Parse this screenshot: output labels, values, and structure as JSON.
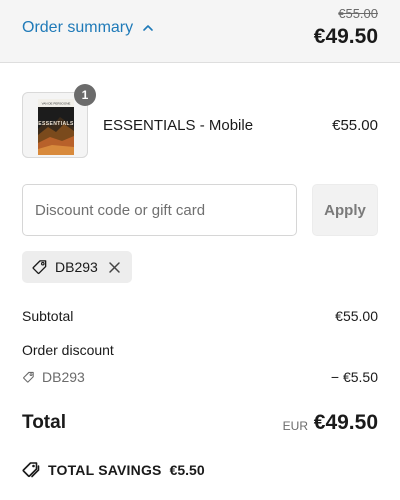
{
  "header": {
    "toggle_label": "Order summary",
    "compare_price": "€55.00",
    "total": "€49.50"
  },
  "line_item": {
    "quantity": "1",
    "name": "ESSENTIALS - Mobile",
    "price": "€55.00",
    "thumbnail": {
      "top_text": "VAN DE PERSOONE",
      "title": "ESSENTIALS"
    }
  },
  "discount_form": {
    "placeholder": "Discount code or gift card",
    "value": "",
    "apply_label": "Apply"
  },
  "applied_code": {
    "code": "DB293",
    "tag_icon": "tag-icon",
    "remove_icon": "close-icon"
  },
  "summary": {
    "subtotal_label": "Subtotal",
    "subtotal_value": "€55.00",
    "order_discount_label": "Order discount",
    "discount_code": "DB293",
    "discount_value": "− €5.50",
    "total_label": "Total",
    "total_currency": "EUR",
    "total_value": "€49.50"
  },
  "savings": {
    "label": "TOTAL SAVINGS",
    "amount": "€5.50"
  },
  "colors": {
    "accent": "#1f7ab8",
    "header_bg": "#f5f5f5",
    "text": "#1a1a1a",
    "muted": "#6b6b6b"
  }
}
